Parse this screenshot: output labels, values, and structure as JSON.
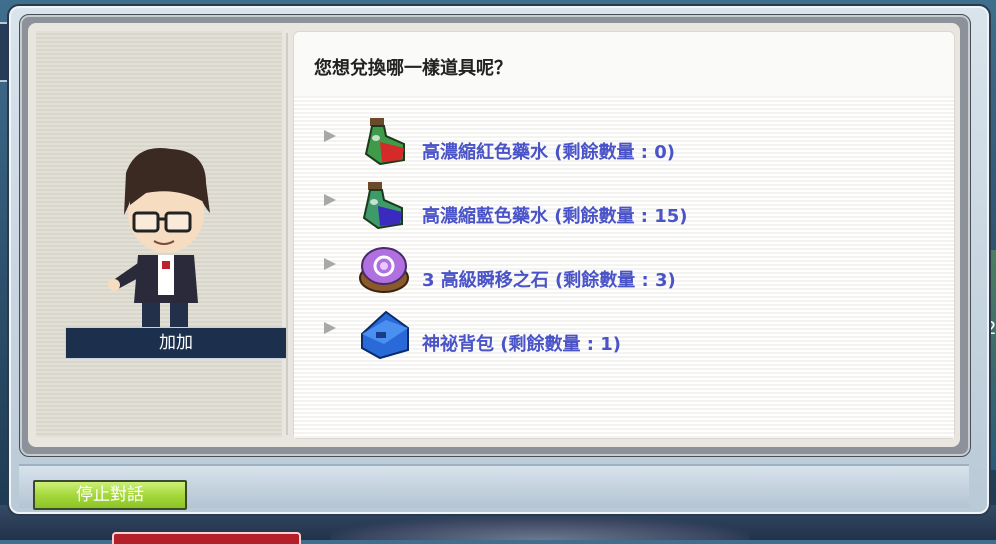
{
  "npc": {
    "name": "加加"
  },
  "dialog": {
    "question": "您想兌換哪一樣道具呢？",
    "options": [
      {
        "label": "高濃縮紅色藥水 (剩餘數量 : 0)",
        "icon": "red-potion-icon"
      },
      {
        "label": "高濃縮藍色藥水 (剩餘數量 : 15)",
        "icon": "blue-potion-icon"
      },
      {
        "label": "3 高級瞬移之石 (剩餘數量 : 3)",
        "icon": "teleport-stone-icon"
      },
      {
        "label": "神祕背包 (剩餘數量 : 1)",
        "icon": "backpack-icon"
      }
    ]
  },
  "buttons": {
    "stop_label": "停止對話"
  },
  "background": {
    "right_edge_text": "2"
  },
  "colors": {
    "option_text": "#4a54c8",
    "stop_button": "#a6d83c",
    "nameplate": "#1c2f4c"
  }
}
